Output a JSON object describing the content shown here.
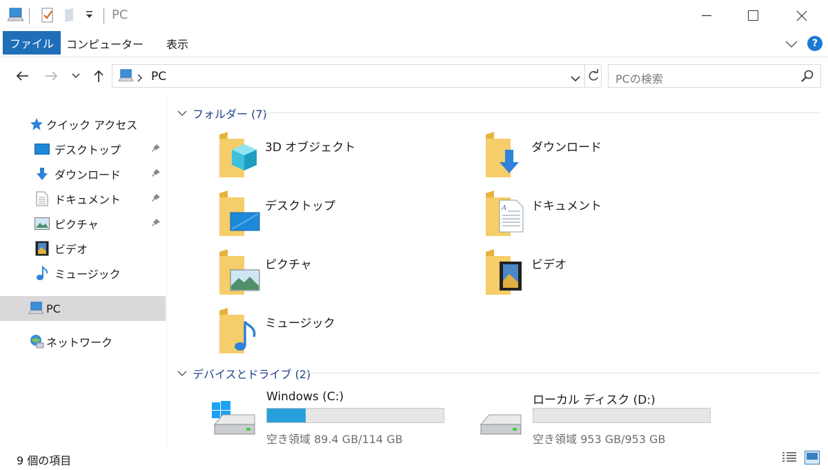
{
  "window": {
    "title": "PC"
  },
  "ribbon": {
    "tabs": [
      {
        "label": "ファイル",
        "active": true
      },
      {
        "label": "コンピューター",
        "active": false
      },
      {
        "label": "表示",
        "active": false
      }
    ],
    "help_label": "?"
  },
  "address": {
    "path": "PC",
    "search_placeholder": "PCの検索"
  },
  "navpane": {
    "quick_access": "クイック アクセス",
    "items": [
      {
        "label": "デスクトップ",
        "icon": "desktop-icon",
        "pinned": true
      },
      {
        "label": "ダウンロード",
        "icon": "download-icon",
        "pinned": true
      },
      {
        "label": "ドキュメント",
        "icon": "document-icon",
        "pinned": true
      },
      {
        "label": "ピクチャ",
        "icon": "pictures-icon",
        "pinned": true
      },
      {
        "label": "ビデオ",
        "icon": "video-icon",
        "pinned": false
      },
      {
        "label": "ミュージック",
        "icon": "music-icon",
        "pinned": false
      }
    ],
    "pc": "PC",
    "network": "ネットワーク"
  },
  "folders_group": {
    "header": "フォルダー (7)",
    "items": [
      {
        "label": "3D オブジェクト",
        "icon": "3d-objects-icon"
      },
      {
        "label": "ダウンロード",
        "icon": "download-icon"
      },
      {
        "label": "デスクトップ",
        "icon": "desktop-icon"
      },
      {
        "label": "ドキュメント",
        "icon": "document-icon"
      },
      {
        "label": "ピクチャ",
        "icon": "pictures-icon"
      },
      {
        "label": "ビデオ",
        "icon": "video-icon"
      },
      {
        "label": "ミュージック",
        "icon": "music-icon"
      }
    ]
  },
  "drives_group": {
    "header": "デバイスとドライブ (2)",
    "items": [
      {
        "label": "Windows (C:)",
        "usage": "空き領域 89.4 GB/114 GB",
        "used_fraction": 0.22
      },
      {
        "label": "ローカル ディスク (D:)",
        "usage": "空き領域 953 GB/953 GB",
        "used_fraction": 0.0
      }
    ]
  },
  "status": {
    "text": "9 個の項目"
  },
  "colors": {
    "accent": "#1f6fb8",
    "group_header": "#1e3f8a",
    "drive_fill": "#26a0da",
    "folder": "#f5c65c"
  }
}
